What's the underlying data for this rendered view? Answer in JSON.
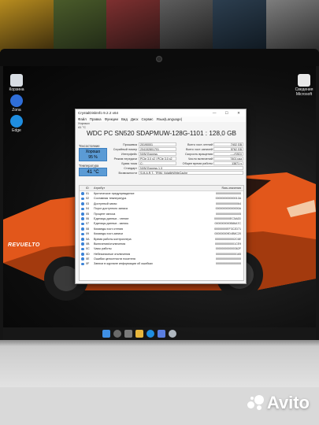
{
  "window": {
    "title": "CrystalDiskInfo 9.2.2 x64",
    "controls": "— ☐ ✕",
    "menu": [
      "Файл",
      "Правка",
      "Функции",
      "Вид",
      "Диск",
      "Сервис",
      "Язык(Language)"
    ]
  },
  "drive_tab": {
    "health": "Хорошо",
    "temp": "41 °C",
    "letter": "C:"
  },
  "drive": {
    "title": "WDC PC SN520 SDAPMUW-128G-1101 : 128,0 GB"
  },
  "status": {
    "health_label": "Техсостояние",
    "health_value": "Хорошо",
    "health_percent": "95 %",
    "temp_label": "Температура",
    "temp_value": "41 °C"
  },
  "info": {
    "firmware_label": "Прошивка",
    "firmware": "20190001",
    "serial_label": "Серийный номер",
    "serial": "204152801701",
    "interface_label": "Интерфейс",
    "interface": "NVM Express",
    "transfer_label": "Режим передачи",
    "transfer": "PCIe 3.0 x2 | PCIe 3.0 x2",
    "letter_label": "Буква тома",
    "letter": "C:",
    "standard_label": "Стандарт",
    "standard": "NVM Express 1.3",
    "features_label": "Возможности",
    "features": "S.M.A.R.T., TRIM, VolatileWriteCache",
    "host_reads_label": "Всего хост-чтений",
    "host_reads": "7402 GB",
    "host_writes_label": "Всего хост-записей",
    "host_writes": "5762 GB",
    "rotation_label": "Скорость вращения",
    "rotation": "----(SSD)",
    "power_count_label": "Число включений",
    "power_count": "7401 раз",
    "power_hours_label": "Общее время работы",
    "power_hours": "13871 ч"
  },
  "table": {
    "headers": {
      "id": "ID",
      "attr": "Атрибут",
      "raw": "Raw-значения"
    },
    "rows": [
      {
        "id": "01",
        "attr": "Критическое предупреждение",
        "raw": "0000000000000000"
      },
      {
        "id": "02",
        "attr": "Составная температура",
        "raw": "000000000000013A"
      },
      {
        "id": "03",
        "attr": "Доступный запас",
        "raw": "0000000000000064"
      },
      {
        "id": "04",
        "attr": "Порог доступного запаса",
        "raw": "000000000000000A"
      },
      {
        "id": "05",
        "attr": "Процент износа",
        "raw": "0000000000000005"
      },
      {
        "id": "06",
        "attr": "Единицы данных - чтение",
        "raw": "0000000000EC5A0D"
      },
      {
        "id": "07",
        "attr": "Единицы данных - запись",
        "raw": "0000000000B86A7C"
      },
      {
        "id": "08",
        "attr": "Команды хост-чтения",
        "raw": "00000000EF3C2D71"
      },
      {
        "id": "09",
        "attr": "Команды хост-записи",
        "raw": "000000009D4B8C20"
      },
      {
        "id": "0A",
        "attr": "Время работы контроллера",
        "raw": "0000000000002C6E"
      },
      {
        "id": "0B",
        "attr": "Включения/отключения",
        "raw": "0000000000001CE9"
      },
      {
        "id": "0C",
        "attr": "Часы работы",
        "raw": "000000000000362F"
      },
      {
        "id": "0D",
        "attr": "Небезопасные отключения",
        "raw": "0000000000000165"
      },
      {
        "id": "0E",
        "attr": "Ошибки целостности носителя",
        "raw": "0000000000000000"
      },
      {
        "id": "0F",
        "attr": "Записи в журнале информации об ошибках",
        "raw": "0000000000000000"
      }
    ]
  },
  "desktop_icons": [
    {
      "label": "Корзина",
      "icon": "recycle-bin-icon",
      "color": "#d8dde3"
    },
    {
      "label": "Zona",
      "icon": "zona-app-icon",
      "color": "#2f6ed8"
    },
    {
      "label": "Edge",
      "icon": "edge-browser-icon",
      "color": "#1f8de0"
    },
    {
      "label": "Сведения Microsoft",
      "icon": "file-icon",
      "color": "#e8e8e8"
    }
  ],
  "taskbar_icons": [
    "windows-start-icon",
    "search-icon",
    "task-view-icon",
    "file-explorer-icon",
    "edge-icon",
    "store-icon",
    "crystaldiskinfo-icon"
  ],
  "car": {
    "badge": "REVUELTO",
    "color": "#e2571b"
  },
  "watermark": {
    "text": "Avito"
  },
  "colors": {
    "health_blue": "#5b9bd5",
    "dot_blue": "#3b82d6",
    "car_orange": "#e2571b"
  }
}
